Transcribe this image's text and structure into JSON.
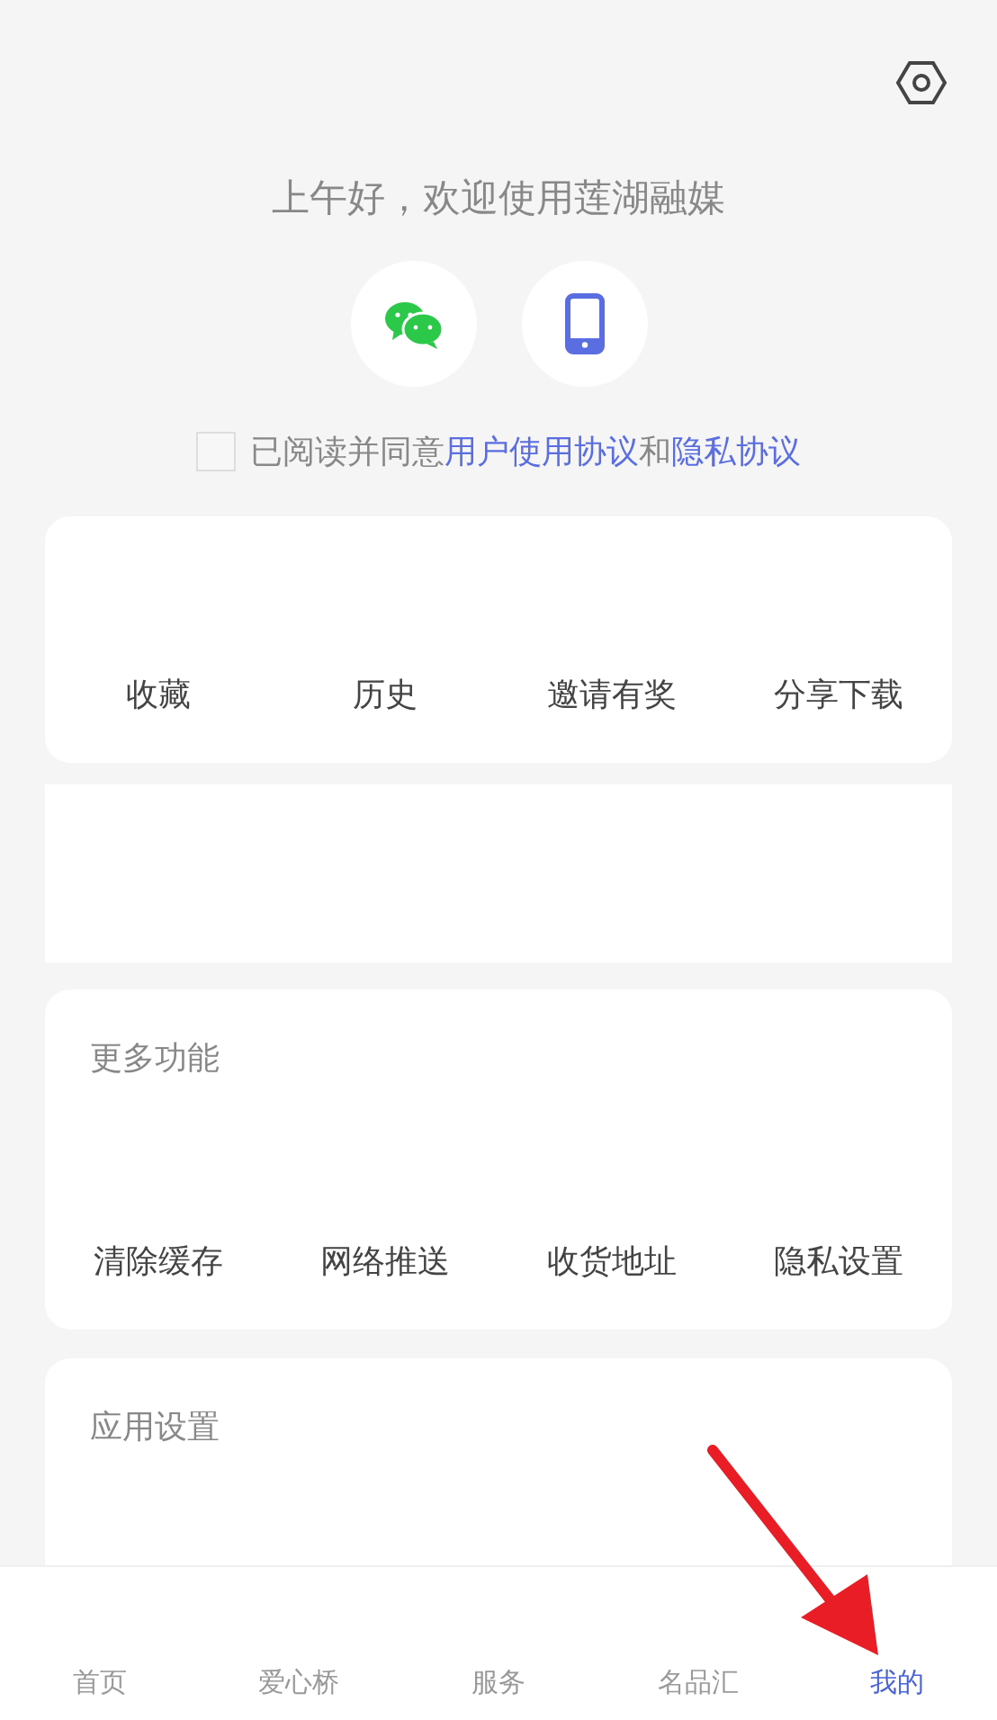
{
  "greeting": "上午好，欢迎使用莲湖融媒",
  "agreement": {
    "checked": false,
    "segments": [
      {
        "kind": "text",
        "text": "已阅读并同意"
      },
      {
        "kind": "link",
        "text": "用户使用协议"
      },
      {
        "kind": "text",
        "text": "和"
      },
      {
        "kind": "link",
        "text": "隐私协议"
      }
    ]
  },
  "quick_actions": [
    "收藏",
    "历史",
    "邀请有奖",
    "分享下载"
  ],
  "more_functions": {
    "title": "更多功能",
    "items": [
      "清除缓存",
      "网络推送",
      "收货地址",
      "隐私设置"
    ]
  },
  "app_settings": {
    "title": "应用设置"
  },
  "tab_bar": [
    {
      "label": "首页",
      "selected": false
    },
    {
      "label": "爱心桥",
      "selected": false
    },
    {
      "label": "服务",
      "selected": false
    },
    {
      "label": "名品汇",
      "selected": false
    },
    {
      "label": "我的",
      "selected": true
    }
  ]
}
